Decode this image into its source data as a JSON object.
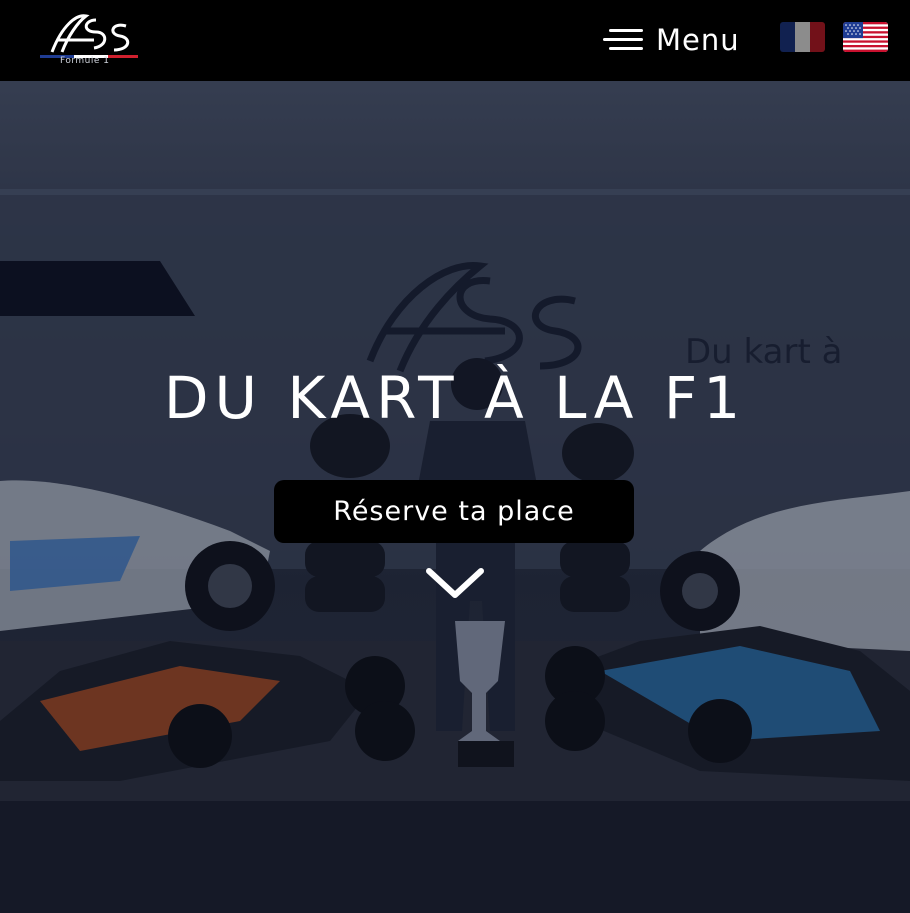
{
  "header": {
    "logo_text": "AFS",
    "logo_subtitle": "Formule 1",
    "menu_label": "Menu",
    "flags": [
      "french-flag-icon",
      "us-flag-icon"
    ]
  },
  "hero": {
    "title": "DU KART À LA F1",
    "cta_label": "Réserve ta place",
    "scroll_icon": "chevron-down-icon",
    "truck_slogan": "Du kart à"
  },
  "colors": {
    "header_bg": "#000000",
    "cta_bg": "#000000",
    "text": "#ffffff",
    "flag_blue": "#1f3c93",
    "flag_red": "#d0202e"
  }
}
